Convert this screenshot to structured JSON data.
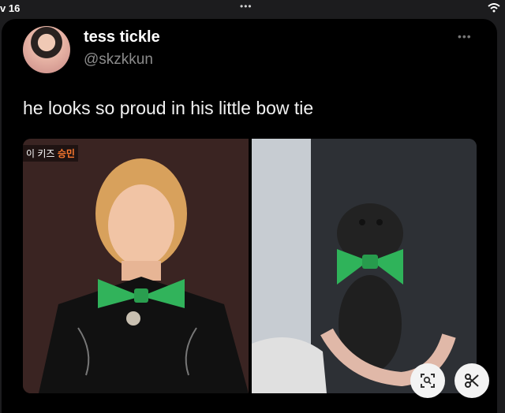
{
  "status_bar": {
    "time": "v 16"
  },
  "tweet": {
    "display_name": "tess tickle",
    "username": "@skzkkun",
    "text": "he looks so proud in his little bow tie",
    "image_overlay_prefix": "이 키즈",
    "image_overlay_name": "승민"
  },
  "icons": {
    "status": "wifi-icon",
    "menu": "more-icon",
    "zoom": "visual-search-icon",
    "cut": "scissors-icon"
  },
  "colors": {
    "background": "#000000",
    "text": "#f2f2f2",
    "secondary_text": "#8b8b8b",
    "bow_tie": "#2fb35a"
  }
}
